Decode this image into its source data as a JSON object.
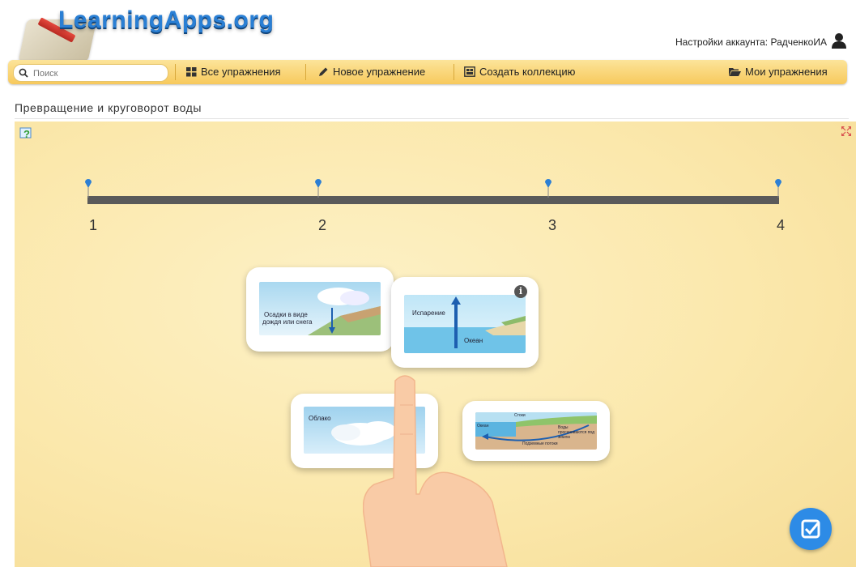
{
  "header": {
    "logo_text": "LearningApps.org",
    "account_label": "Настройки аккаунта: РадченкоИА",
    "account_icon": "user-icon"
  },
  "toolbar": {
    "search_placeholder": "Поиск",
    "all_exercises": "Все упражнения",
    "new_exercise": "Новое упражнение",
    "create_collection": "Создать коллекцию",
    "my_exercises": "Мои упражнения"
  },
  "page": {
    "title": "Превращение и круговорот воды"
  },
  "timeline": {
    "ticks": [
      "1",
      "2",
      "3",
      "4"
    ]
  },
  "cards": [
    {
      "labels": [
        "Осадки в виде",
        "дождя или снега"
      ]
    },
    {
      "labels": [
        "Испарение",
        "Океан"
      ]
    },
    {
      "labels": [
        "Облако"
      ]
    },
    {
      "labels": [
        "Стоки",
        "Океан",
        "Воды просачиваются под землю",
        "Подземные потоки"
      ]
    }
  ],
  "colors": {
    "accent": "#2d8be6",
    "toolbar": "#f7c95c",
    "background": "#fbe8ac"
  }
}
